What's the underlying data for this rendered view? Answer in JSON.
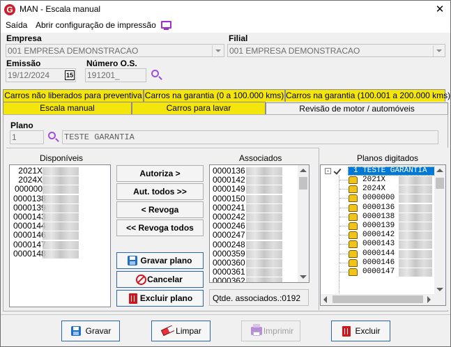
{
  "window": {
    "title": "MAN - Escala manual",
    "close_glyph": "✕",
    "logo_letter": "G"
  },
  "menu": {
    "items": [
      "Saída",
      "Abrir configuração de impressão"
    ],
    "monitor_icon": "monitor-icon"
  },
  "form": {
    "empresa_label": "Empresa",
    "empresa_value": "001 EMPRESA DEMONSTRACAO",
    "filial_label": "Filial",
    "filial_value": "001 EMPRESA DEMONSTRACAO",
    "emissao_label": "Emissão",
    "emissao_value": "19/12/2024",
    "calendar_day": "15",
    "numero_os_label": "Número O.S.",
    "numero_os_value": "191201_"
  },
  "tabs": {
    "row1": [
      "Carros não liberados para preventiva",
      "Carros na garantia (0 a 100.000 kms)",
      "Carros na garantia (100.001 a 200.000 kms)"
    ],
    "row2": [
      "Escala manual",
      "Carros para lavar",
      "Revisão de motor / automóveis"
    ]
  },
  "plano": {
    "label": "Plano",
    "number": "1",
    "description": "TESTE GARANTIA"
  },
  "disponiveis": {
    "title": "Disponíveis",
    "items": [
      "2021X",
      "2024X",
      "000000",
      "0000138",
      "0000139",
      "0000143",
      "0000144",
      "0000146",
      "0000147",
      "0000148"
    ]
  },
  "actions": {
    "autoriza": "Autoriza >",
    "aut_todos": "Aut. todos >>",
    "revoga": "< Revoga",
    "revoga_todos": "<< Revoga todos",
    "gravar_plano": "Gravar plano",
    "cancelar": "Cancelar",
    "excluir_plano": "Excluir plano"
  },
  "associados": {
    "title": "Associados",
    "items": [
      "0000136",
      "0000142",
      "0000149",
      "0000150",
      "0000241",
      "0000242",
      "0000246",
      "0000247",
      "0000248",
      "0000359",
      "0000360",
      "0000361",
      "0000362"
    ],
    "count_label": "Qtde. associados.:",
    "count_value": "0192"
  },
  "planos_digitados": {
    "title": "Planos digitados",
    "root": "1 TESTE GARANTIA",
    "children": [
      "2021X",
      "2024X",
      "0000000",
      "0000136",
      "0000138",
      "0000139",
      "0000142",
      "0000143",
      "0000144",
      "0000146",
      "0000147"
    ]
  },
  "footer": {
    "gravar": "Gravar",
    "limpar": "Limpar",
    "imprimir": "Imprimir",
    "excluir": "Excluir"
  },
  "colors": {
    "tab_yellow": "#f4e60c",
    "selection_blue": "#0078d7",
    "search_purple": "#9c4fd8",
    "logo_red": "#c8202c"
  }
}
